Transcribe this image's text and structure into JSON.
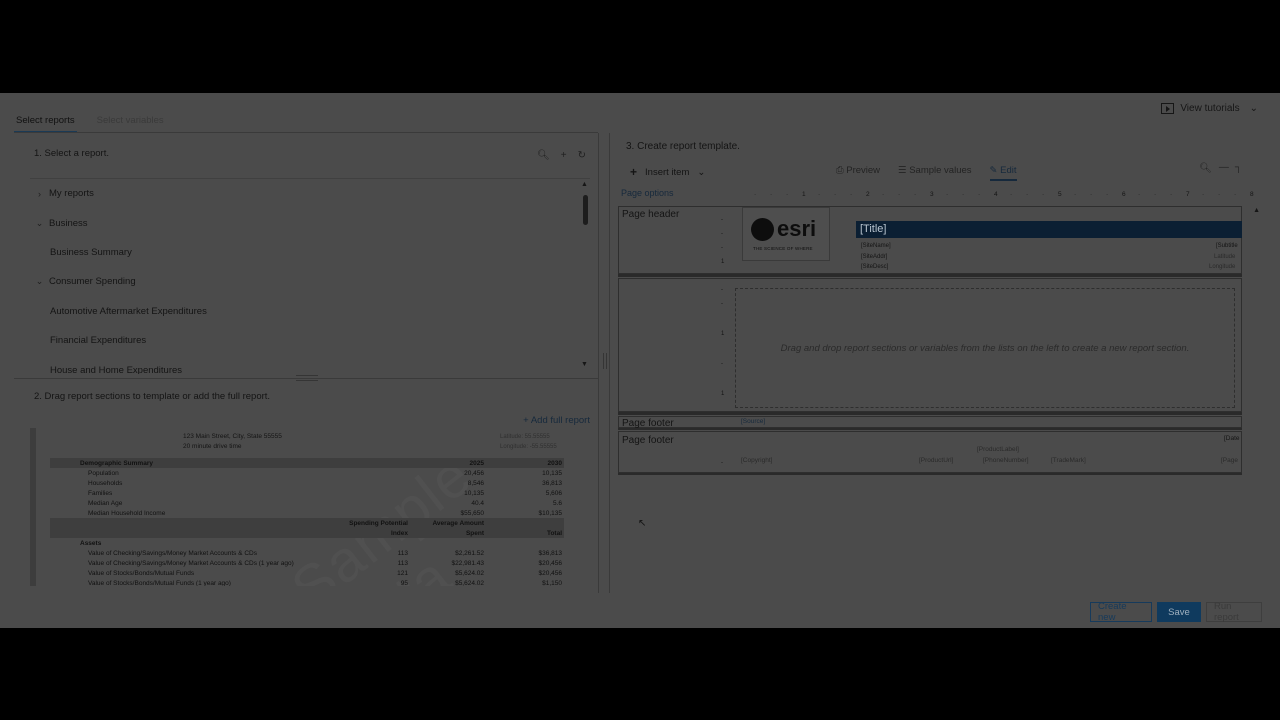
{
  "header": {
    "tutorials_label": "View tutorials",
    "tutorials_chevron": "⌄"
  },
  "tabs": [
    {
      "label": "Select reports",
      "active": true
    },
    {
      "label": "Select variables",
      "active": false
    }
  ],
  "left": {
    "step1": "1.  Select a report.",
    "tree": [
      {
        "label": "My reports",
        "type": "folder",
        "expanded": false
      },
      {
        "label": "Business",
        "type": "folder",
        "expanded": true
      },
      {
        "label": "Business Summary",
        "type": "leaf"
      },
      {
        "label": "Consumer Spending",
        "type": "folder",
        "expanded": true
      },
      {
        "label": "Automotive Aftermarket Expenditures",
        "type": "leaf"
      },
      {
        "label": "Financial Expenditures",
        "type": "leaf"
      },
      {
        "label": "House and Home Expenditures",
        "type": "leaf"
      }
    ],
    "step2": "2.  Drag report sections to template or add the full report.",
    "add_full_report": "Add full report",
    "preview": {
      "address": "123 Main Street, City, State 55555",
      "drive_time": "20 minute drive time",
      "latitude": "Latitude: 55.55555",
      "longitude": "Longitude: -55.55555",
      "watermark": "Sample Data",
      "rows": [
        {
          "type": "head",
          "label": "Demographic Summary",
          "c1": "",
          "c2": "2025",
          "c3": "2030"
        },
        {
          "type": "row",
          "label": "Population",
          "c1": "",
          "c2": "20,456",
          "c3": "10,135"
        },
        {
          "type": "row",
          "label": "Households",
          "c1": "",
          "c2": "8,546",
          "c3": "36,813"
        },
        {
          "type": "row",
          "label": "Families",
          "c1": "",
          "c2": "10,135",
          "c3": "5,606"
        },
        {
          "type": "row",
          "label": "Median Age",
          "c1": "",
          "c2": "40.4",
          "c3": "5.6"
        },
        {
          "type": "row",
          "label": "Median Household Income",
          "c1": "",
          "c2": "$55,650",
          "c3": "$10,135"
        },
        {
          "type": "colhead",
          "label": "",
          "c1": "Spending Potential",
          "c2": "Average Amount",
          "c3": ""
        },
        {
          "type": "colhead",
          "label": "",
          "c1": "Index",
          "c2": "Spent",
          "c3": "Total"
        },
        {
          "type": "group",
          "label": "Assets",
          "c1": "",
          "c2": "",
          "c3": ""
        },
        {
          "type": "row",
          "label": "Value of Checking/Savings/Money Market Accounts & CDs",
          "c1": "113",
          "c2": "$2,261.52",
          "c3": "$36,813"
        },
        {
          "type": "row",
          "label": "Value of Checking/Savings/Money Market Accounts & CDs (1 year ago)",
          "c1": "113",
          "c2": "$22,981.43",
          "c3": "$20,456"
        },
        {
          "type": "row",
          "label": "Value of Stocks/Bonds/Mutual Funds",
          "c1": "121",
          "c2": "$5,624.02",
          "c3": "$20,456"
        },
        {
          "type": "row",
          "label": "Value of Stocks/Bonds/Mutual Funds (1 year ago)",
          "c1": "95",
          "c2": "$5,624.02",
          "c3": "$1,150"
        }
      ]
    }
  },
  "right": {
    "step3": "3.  Create report template.",
    "insert_item": "Insert item",
    "preview_btn": "Preview",
    "sample_values_btn": "Sample values",
    "edit_btn": "Edit",
    "page_options": "Page options",
    "ruler": [
      "1",
      "2",
      "3",
      "4",
      "5",
      "6",
      "7",
      "8"
    ],
    "page_header_label": "Page header",
    "logo_text": "esri",
    "logo_tagline": "THE SCIENCE OF WHERE",
    "title_field": "[Title]",
    "site_name": "[SiteName]",
    "site_addr": "[SiteAddr]",
    "site_desc": "[SiteDesc]",
    "subtitle": "[Subtitle",
    "latitude_field": "Latitude",
    "longitude_field": "Longitude",
    "dnd_text": "Drag and drop report sections or variables from the lists on the left to create a new report section.",
    "page_footer_label_1": "Page footer",
    "source_field": "[Source]",
    "page_footer_label_2": "Page footer",
    "date_field": "[Date",
    "product_label": "[ProductLabel]",
    "copyright": "[Copyright]",
    "product_url": "[ProductUrl]",
    "phone_number": "[PhoneNumber]",
    "trademark": "[TradeMark]",
    "page_field": "[Page"
  },
  "footer_buttons": {
    "create_new": "Create new",
    "save": "Save",
    "run_report": "Run report"
  }
}
